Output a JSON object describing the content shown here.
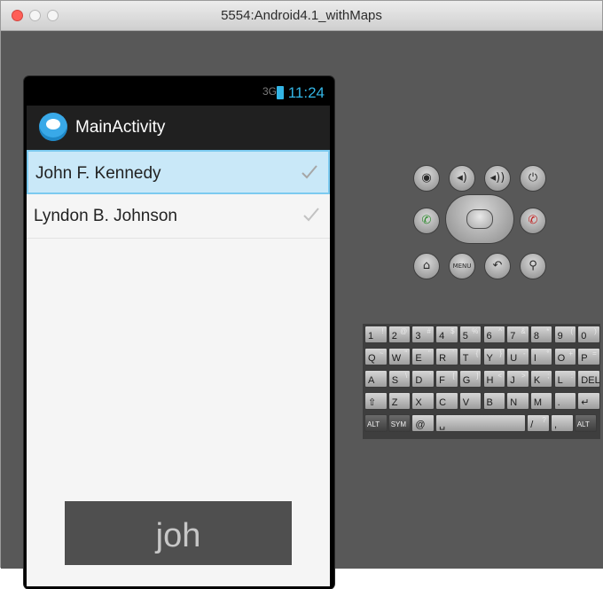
{
  "window": {
    "title": "5554:Android4.1_withMaps"
  },
  "statusbar": {
    "network": "3G",
    "time": "11:24"
  },
  "actionbar": {
    "title": "MainActivity"
  },
  "list": {
    "items": [
      {
        "label": "John F. Kennedy",
        "selected": true
      },
      {
        "label": "Lyndon B. Johnson",
        "selected": false
      }
    ]
  },
  "toast": {
    "text": "joh"
  },
  "hardware_buttons": {
    "row1": [
      {
        "icon": "camera-icon",
        "glyph": "◉"
      },
      {
        "icon": "volume-down-icon",
        "glyph": "◂)"
      },
      {
        "icon": "volume-up-icon",
        "glyph": "◂))"
      },
      {
        "icon": "power-icon",
        "glyph": "⏻"
      }
    ],
    "call": {
      "icon": "call-icon",
      "glyph": "✆"
    },
    "end": {
      "icon": "end-call-icon",
      "glyph": "✆"
    },
    "row3": [
      {
        "icon": "home-icon",
        "glyph": "⌂"
      },
      {
        "icon": "menu-icon",
        "glyph": "MENU"
      },
      {
        "icon": "back-icon",
        "glyph": "↶"
      },
      {
        "icon": "search-icon",
        "glyph": "⚲"
      }
    ]
  },
  "keyboard": {
    "row1": [
      [
        "1",
        "!"
      ],
      [
        "2",
        "@"
      ],
      [
        "3",
        "#"
      ],
      [
        "4",
        "$"
      ],
      [
        "5",
        "%"
      ],
      [
        "6",
        "^"
      ],
      [
        "7",
        "&"
      ],
      [
        "8",
        "*"
      ],
      [
        "9",
        "("
      ],
      [
        "0",
        ")"
      ]
    ],
    "row2": [
      [
        "Q",
        "~"
      ],
      [
        "W",
        "\""
      ],
      [
        "E",
        "\""
      ],
      [
        "R",
        "`"
      ],
      [
        "T",
        "{"
      ],
      [
        "Y",
        "}"
      ],
      [
        "U",
        "-"
      ],
      [
        "I",
        "°"
      ],
      [
        "O",
        "+"
      ],
      [
        "P",
        "="
      ]
    ],
    "row3": [
      [
        "A",
        ""
      ],
      [
        "S",
        "\\"
      ],
      [
        "D",
        "'"
      ],
      [
        "F",
        "["
      ],
      [
        "G",
        "]"
      ],
      [
        "H",
        "<"
      ],
      [
        "J",
        ">"
      ],
      [
        "K",
        ";"
      ],
      [
        "L",
        ":"
      ],
      [
        "DEL",
        ""
      ]
    ],
    "row4": [
      [
        "⇧",
        ""
      ],
      [
        "Z",
        ""
      ],
      [
        "X",
        ""
      ],
      [
        "C",
        ""
      ],
      [
        "V",
        ""
      ],
      [
        "B",
        ""
      ],
      [
        "N",
        ""
      ],
      [
        "M",
        ""
      ],
      [
        ".",
        ""
      ],
      [
        "↵",
        ""
      ]
    ],
    "row5": [
      [
        "ALT",
        ""
      ],
      [
        "SYM",
        ""
      ],
      [
        "@",
        ""
      ],
      [
        "␣",
        ""
      ],
      [
        "/",
        "?"
      ],
      [
        ",",
        ""
      ],
      [
        "ALT",
        ""
      ]
    ]
  }
}
